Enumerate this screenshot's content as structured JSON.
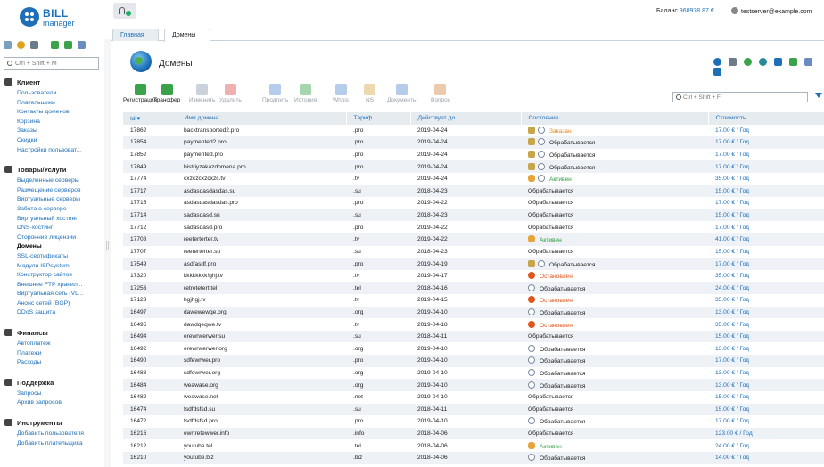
{
  "app": {
    "logo_word": "BILL",
    "logo_sub": "manager",
    "balance_label": "Баланс",
    "balance_value": "960978.87 €",
    "user_email": "testserver@example.com"
  },
  "sidebar": {
    "search_placeholder": "Ctrl + Shift + M",
    "groups": [
      {
        "title": "Клиент",
        "items": [
          "Пользователи",
          "Плательщики",
          "Контакты доменов",
          "Корзина",
          "Заказы",
          "Скидки",
          "Настройки пользоват..."
        ]
      },
      {
        "title": "Товары/Услуги",
        "items": [
          "Выделенные серверы",
          "Размещение серверов",
          "Виртуальные серверы",
          "Забота о сервере",
          "Виртуальный хостинг",
          "DNS-хостинг",
          "Сторонние лицензии",
          "Домены",
          "SSL-сертификаты",
          "Модули ISPsystem",
          "Конструктор сайтов",
          "Внешнее FTP хранил...",
          "Виртуальная сеть (VL...",
          "Анонс сетей (BGP)",
          "DDoS защита"
        ]
      },
      {
        "title": "Финансы",
        "items": [
          "Автоплатеж",
          "Платежи",
          "Расходы"
        ]
      },
      {
        "title": "Поддержка",
        "items": [
          "Запросы",
          "Архив запросов"
        ]
      },
      {
        "title": "Инструменты",
        "items": [
          "Добавить пользователя",
          "Добавить плательщика"
        ]
      }
    ],
    "active_item": "Домены"
  },
  "tabs": [
    {
      "label": "Главная"
    },
    {
      "label": "Домены",
      "closable": true
    }
  ],
  "page": {
    "title": "Домены",
    "search_placeholder": "Ctrl + Shift + F"
  },
  "toolbar": [
    {
      "label": "Регистрация",
      "enabled": true,
      "icon": "register-icon",
      "color": "#3aa34a"
    },
    {
      "label": "Трансфер",
      "enabled": true,
      "icon": "transfer-icon",
      "color": "#3aa34a"
    },
    {
      "label": "Изменить",
      "enabled": false,
      "icon": "edit-icon",
      "color": "#8a9bb0"
    },
    {
      "label": "Удалить",
      "enabled": false,
      "icon": "delete-icon",
      "color": "#d9534f"
    },
    {
      "label": "Продлить",
      "enabled": false,
      "icon": "renew-icon",
      "color": "#5b8fd0"
    },
    {
      "label": "История",
      "enabled": false,
      "icon": "history-icon",
      "color": "#3aa34a"
    },
    {
      "label": "Whois",
      "enabled": false,
      "icon": "whois-icon",
      "color": "#5b8fd0"
    },
    {
      "label": "NS",
      "enabled": false,
      "icon": "ns-icon",
      "color": "#d9a84a"
    },
    {
      "label": "Документы",
      "enabled": false,
      "icon": "documents-icon",
      "color": "#5b8fd0"
    },
    {
      "label": "Вопрос",
      "enabled": false,
      "icon": "question-icon",
      "color": "#d98a4a"
    }
  ],
  "table": {
    "columns": [
      "Id",
      "Имя домена",
      "Тариф",
      "Действует до",
      "Состояние",
      "Стоимость"
    ],
    "rows": [
      {
        "id": "17862",
        "name": "backtransported2.pro",
        "tariff": ".pro",
        "until": "2019-04-24",
        "icons": [
          "gear",
          "v"
        ],
        "status": "Заказан",
        "kind": "ordered",
        "cost": "17.00 € / Год"
      },
      {
        "id": "17854",
        "name": "paymented2.pro",
        "tariff": ".pro",
        "until": "2019-04-24",
        "icons": [
          "gear",
          "v"
        ],
        "status": "Обрабатывается",
        "kind": "proc",
        "cost": "17.00 € / Год"
      },
      {
        "id": "17852",
        "name": "paymented.pro",
        "tariff": ".pro",
        "until": "2019-04-24",
        "icons": [
          "gear",
          "v"
        ],
        "status": "Обрабатывается",
        "kind": "proc",
        "cost": "17.00 € / Год"
      },
      {
        "id": "17849",
        "name": "bistriyzakazdomena.pro",
        "tariff": ".pro",
        "until": "2019-04-24",
        "icons": [
          "gear",
          "v"
        ],
        "status": "Обрабатывается",
        "kind": "proc",
        "cost": "17.00 € / Год"
      },
      {
        "id": "17774",
        "name": "cxzczcxzcxzc.tv",
        "tariff": ".tv",
        "until": "2019-04-24",
        "icons": [
          "key",
          "v"
        ],
        "status": "Активен",
        "kind": "active",
        "cost": "35.00 € / Год"
      },
      {
        "id": "17717",
        "name": "asdasdasdasdas.su",
        "tariff": ".su",
        "until": "2018-04-23",
        "icons": [],
        "status": "Обрабатывается",
        "kind": "proc",
        "cost": "15.00 € / Год"
      },
      {
        "id": "17715",
        "name": "asdasdasdasdas.pro",
        "tariff": ".pro",
        "until": "2019-04-22",
        "icons": [],
        "status": "Обрабатывается",
        "kind": "proc",
        "cost": "17.00 € / Год"
      },
      {
        "id": "17714",
        "name": "sadasdasd.su",
        "tariff": ".su",
        "until": "2018-04-23",
        "icons": [],
        "status": "Обрабатывается",
        "kind": "proc",
        "cost": "15.00 € / Год"
      },
      {
        "id": "17712",
        "name": "sadasdasd.pro",
        "tariff": ".pro",
        "until": "2019-04-22",
        "icons": [],
        "status": "Обрабатывается",
        "kind": "proc",
        "cost": "17.00 € / Год"
      },
      {
        "id": "17708",
        "name": "reeterterter.tv",
        "tariff": ".tv",
        "until": "2019-04-22",
        "icons": [
          "key"
        ],
        "status": "Активен",
        "kind": "active",
        "cost": "41.00 € / Год"
      },
      {
        "id": "17707",
        "name": "reeterterter.su",
        "tariff": ".su",
        "until": "2018-04-23",
        "icons": [],
        "status": "Обрабатывается",
        "kind": "proc",
        "cost": "15.00 € / Год"
      },
      {
        "id": "17549",
        "name": "asdfasdf.pro",
        "tariff": ".pro",
        "until": "2019-04-19",
        "icons": [
          "gear",
          "v"
        ],
        "status": "Обрабатывается",
        "kind": "proc",
        "cost": "17.00 € / Год"
      },
      {
        "id": "17320",
        "name": "kkkkkkkk!ghj.tv",
        "tariff": ".tv",
        "until": "2019-04-17",
        "icons": [
          "stop"
        ],
        "status": "Остановлен",
        "kind": "stopped",
        "cost": "35.00 € / Год"
      },
      {
        "id": "17253",
        "name": "retretetert.tel",
        "tariff": ".tel",
        "until": "2018-04-16",
        "icons": [
          "v"
        ],
        "status": "Обрабатывается",
        "kind": "proc",
        "cost": "24.00 € / Год"
      },
      {
        "id": "17123",
        "name": "hgjhgj.tv",
        "tariff": ".tv",
        "until": "2019-04-15",
        "icons": [
          "stop"
        ],
        "status": "Остановлен",
        "kind": "stopped",
        "cost": "35.00 € / Год"
      },
      {
        "id": "16497",
        "name": "dawewewqe.org",
        "tariff": ".org",
        "until": "2019-04-10",
        "icons": [
          "v"
        ],
        "status": "Обрабатывается",
        "kind": "proc",
        "cost": "13.00 € / Год"
      },
      {
        "id": "16495",
        "name": "dawdqeqwe.tv",
        "tariff": ".tv",
        "until": "2019-04-18",
        "icons": [
          "stop"
        ],
        "status": "Остановлен",
        "kind": "stopped",
        "cost": "35.00 € / Год"
      },
      {
        "id": "16494",
        "name": "erewrwerwer.su",
        "tariff": ".su",
        "until": "2018-04-11",
        "icons": [],
        "status": "Обрабатывается",
        "kind": "proc",
        "cost": "15.00 € / Год"
      },
      {
        "id": "16492",
        "name": "erewrwerwer.org",
        "tariff": ".org",
        "until": "2019-04-10",
        "icons": [
          "v"
        ],
        "status": "Обрабатывается",
        "kind": "proc",
        "cost": "13.00 € / Год"
      },
      {
        "id": "16490",
        "name": "sdfewrwer.pro",
        "tariff": ".pro",
        "until": "2019-04-10",
        "icons": [
          "v"
        ],
        "status": "Обрабатывается",
        "kind": "proc",
        "cost": "17.00 € / Год"
      },
      {
        "id": "16488",
        "name": "sdfewrwer.org",
        "tariff": ".org",
        "until": "2019-04-10",
        "icons": [
          "v"
        ],
        "status": "Обрабатывается",
        "kind": "proc",
        "cost": "13.00 € / Год"
      },
      {
        "id": "16484",
        "name": "weawase.org",
        "tariff": ".org",
        "until": "2019-04-10",
        "icons": [
          "v"
        ],
        "status": "Обрабатывается",
        "kind": "proc",
        "cost": "13.00 € / Год"
      },
      {
        "id": "16482",
        "name": "weawase.net",
        "tariff": ".net",
        "until": "2019-04-10",
        "icons": [],
        "status": "Обрабатывается",
        "kind": "proc",
        "cost": "15.00 € / Год"
      },
      {
        "id": "16474",
        "name": "fsdfdsfsd.su",
        "tariff": ".su",
        "until": "2018-04-11",
        "icons": [],
        "status": "Обрабатывается",
        "kind": "proc",
        "cost": "15.00 € / Год"
      },
      {
        "id": "16472",
        "name": "fsdfdsfsd.pro",
        "tariff": ".pro",
        "until": "2019-04-10",
        "icons": [
          "v"
        ],
        "status": "Обрабатывается",
        "kind": "proc",
        "cost": "17.00 € / Год"
      },
      {
        "id": "16216",
        "name": "ewrtretewwer.info",
        "tariff": ".info",
        "until": "2018-04-06",
        "icons": [],
        "status": "Обрабатывается",
        "kind": "proc",
        "cost": "123.00 € / Год"
      },
      {
        "id": "16212",
        "name": "youtube.tel",
        "tariff": ".tel",
        "until": "2018-04-06",
        "icons": [
          "key"
        ],
        "status": "Активен",
        "kind": "active",
        "cost": "24.00 € / Год"
      },
      {
        "id": "16210",
        "name": "youtube.biz",
        "tariff": ".biz",
        "until": "2018-04-06",
        "icons": [
          "v"
        ],
        "status": "Обрабатывается",
        "kind": "proc",
        "cost": "14.00 € / Год"
      }
    ]
  }
}
